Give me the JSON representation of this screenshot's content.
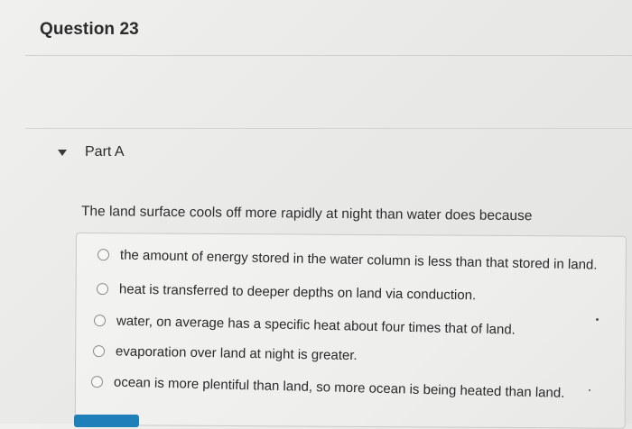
{
  "question": {
    "title": "Question 23"
  },
  "part": {
    "label": "Part A",
    "expanded": true
  },
  "prompt": "The land surface cools off more rapidly at night than water does because",
  "choices": [
    "the amount of energy stored in the water column is less than that stored in land.",
    "heat is transferred to deeper depths on land via conduction.",
    "water, on average has a specific heat about four times that of land.",
    "evaporation over land at night is greater.",
    "ocean is more plentiful than land, so more ocean is being heated than land."
  ],
  "colors": {
    "submit_button": "#1f7fb8"
  },
  "icons": {
    "part_toggle": "caret-down-icon",
    "choice": "radio-unselected-icon"
  }
}
